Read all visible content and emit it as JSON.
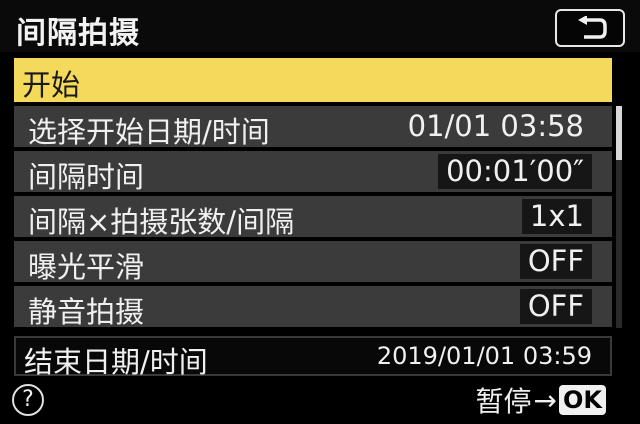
{
  "header": {
    "title": "间隔拍摄",
    "back_icon": "return-arrow-icon"
  },
  "menu": {
    "start": "开始",
    "rows": [
      {
        "label": "选择开始日期/时间",
        "value": "01/01 03:58"
      },
      {
        "label": "间隔时间",
        "value": "00:01′00″"
      },
      {
        "label": "间隔×拍摄张数/间隔",
        "value": "1x1"
      },
      {
        "label": "曝光平滑",
        "value": "OFF"
      },
      {
        "label": "静音拍摄",
        "value": "OFF"
      }
    ],
    "end": {
      "label": "结束日期/时间",
      "value": "2019/01/01 03:59"
    }
  },
  "footer": {
    "help": "?",
    "hint": "暂停",
    "arrow": "→",
    "ok": "OK"
  },
  "colors": {
    "highlight": "#f4d95a",
    "row_bg": "#3b3b3b",
    "background": "#000000"
  }
}
